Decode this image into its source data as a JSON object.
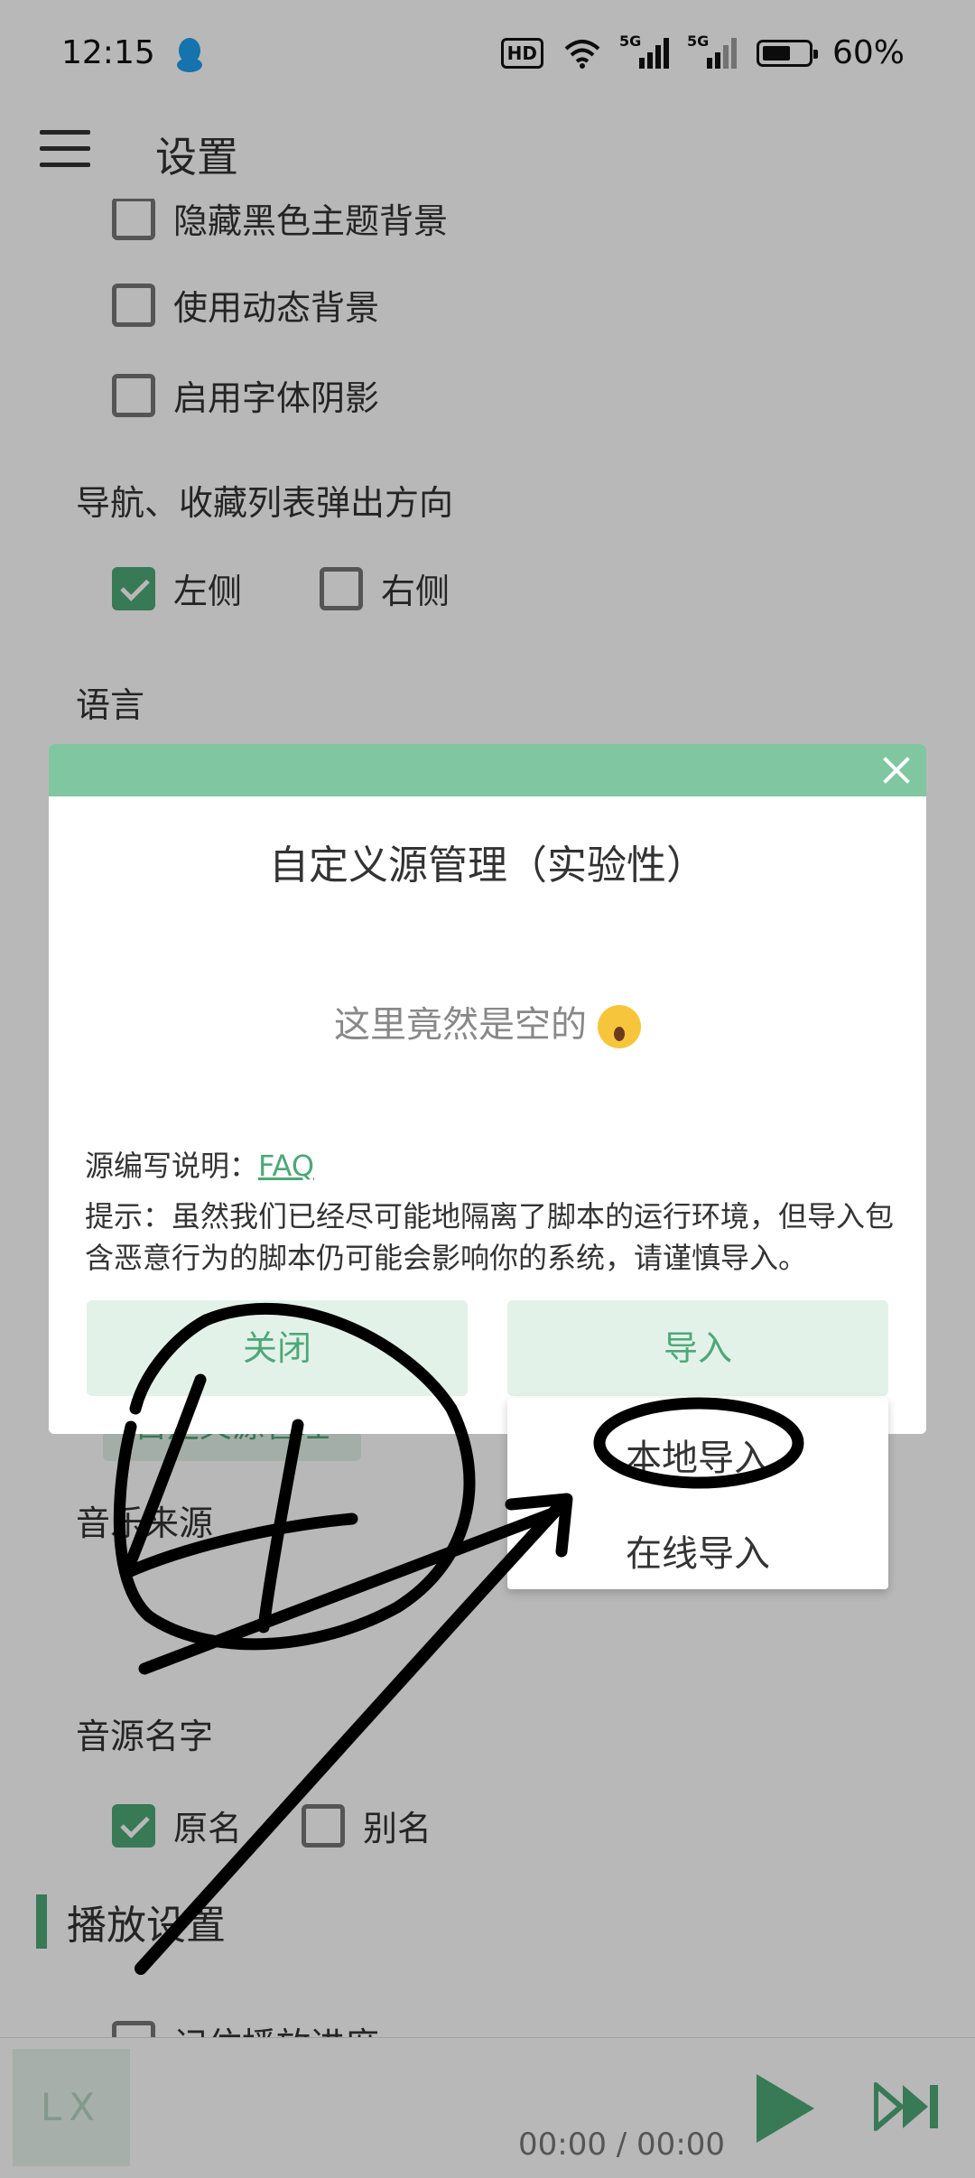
{
  "status_bar": {
    "time": "12:15",
    "hd_label": "HD",
    "net_label_1": "5G",
    "net_label_2": "5G",
    "battery_text": "60%"
  },
  "header": {
    "title": "设置"
  },
  "settings": {
    "hide_theme_bg": "隐藏黑色主题背景",
    "dynamic_bg": "使用动态背景",
    "font_shadow": "启用字体阴影",
    "popup_direction_label": "导航、收藏列表弹出方向",
    "left_label": "左侧",
    "right_label": "右侧",
    "language_label": "语言",
    "music_source_label": "音乐来源",
    "custom_source_button": "自定义源管理",
    "source_name_label": "音源名字",
    "original_name": "原名",
    "alias_name": "别名",
    "play_settings_heading": "播放设置",
    "remember_progress": "记住播放进度"
  },
  "dialog": {
    "title": "自定义源管理（实验性）",
    "empty_text": "这里竟然是空的",
    "doc_label": "源编写说明：",
    "faq_link": "FAQ",
    "tip": "提示：虽然我们已经尽可能地隔离了脚本的运行环境，但导入包含恶意行为的脚本仍可能会影响你的系统，请谨慎导入。",
    "close_button": "关闭",
    "import_button": "导入"
  },
  "dropdown": {
    "local_import": "本地导入",
    "online_import": "在线导入"
  },
  "player": {
    "cover_text": "LX",
    "time": "00:00 / 00:00"
  },
  "colors": {
    "accent": "#4ea878",
    "accent_light": "#e3f2e9",
    "dialog_topbar": "#80c6a0"
  }
}
